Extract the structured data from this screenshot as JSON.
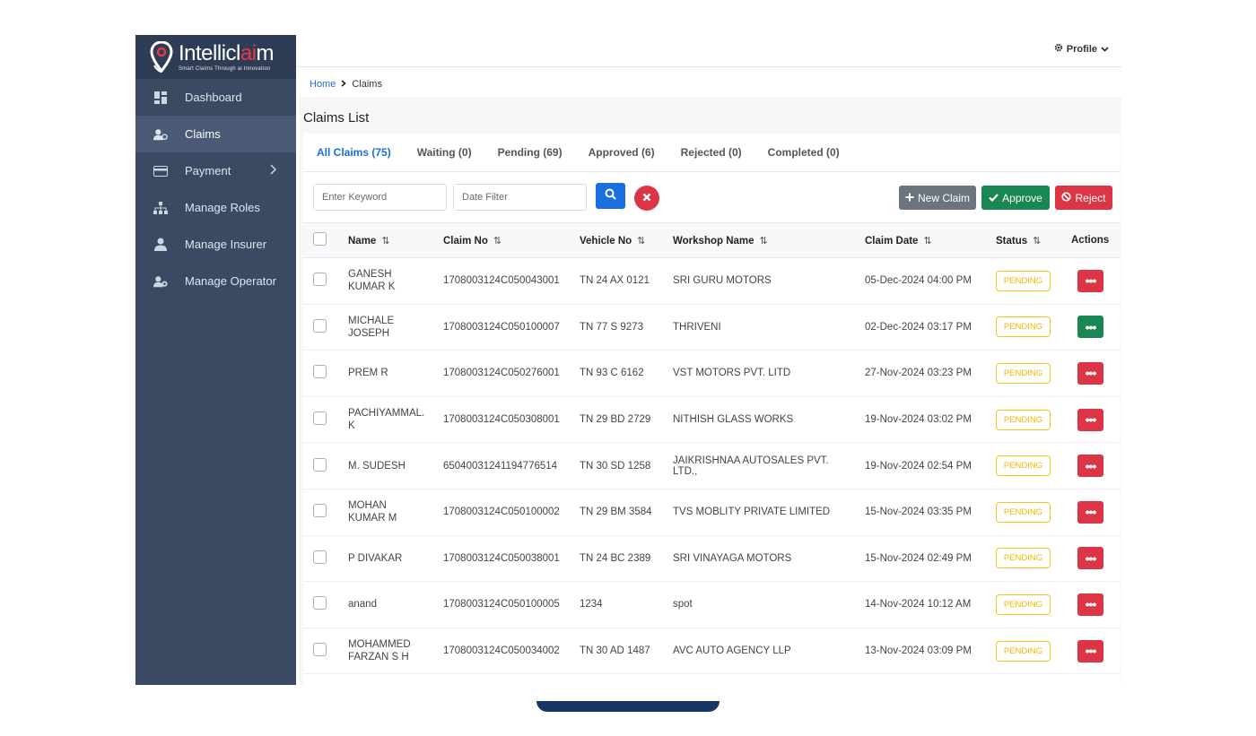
{
  "brand": {
    "name_pre": "Intellicl",
    "name_hl": "ai",
    "name_post": "m",
    "tagline": "Smart Claims Through ai Innovation"
  },
  "sidebar": {
    "items": [
      {
        "label": "Dashboard",
        "icon": "dashboard-icon"
      },
      {
        "label": "Claims",
        "icon": "claims-user-icon",
        "active": true
      },
      {
        "label": "Payment",
        "icon": "card-icon",
        "has_submenu": true
      },
      {
        "label": "Manage Roles",
        "icon": "sitemap-icon"
      },
      {
        "label": "Manage Insurer",
        "icon": "user-tie-icon"
      },
      {
        "label": "Manage Operator",
        "icon": "user-gear-icon"
      }
    ]
  },
  "topbar": {
    "profile_label": "Profile"
  },
  "breadcrumb": {
    "home": "Home",
    "current": "Claims"
  },
  "page": {
    "title": "Claims List"
  },
  "tabs": [
    {
      "label": "All Claims (75)",
      "active": true
    },
    {
      "label": "Waiting (0)"
    },
    {
      "label": "Pending (69)"
    },
    {
      "label": "Approved (6)"
    },
    {
      "label": "Rejected (0)"
    },
    {
      "label": "Completed (0)"
    }
  ],
  "filters": {
    "keyword_placeholder": "Enter Keyword",
    "date_placeholder": "Date Filter"
  },
  "actions": {
    "new_claim": "New Claim",
    "approve": "Approve",
    "reject": "Reject"
  },
  "table": {
    "columns": [
      "Name",
      "Claim No",
      "Vehicle No",
      "Workshop Name",
      "Claim Date",
      "Status",
      "Actions"
    ],
    "rows": [
      {
        "name": [
          "GANESH",
          "KUMAR K"
        ],
        "claim_no": "1708003124C050043001",
        "vehicle_no": "TN 24 AX 0121",
        "workshop": "SRI GURU MOTORS",
        "date": "05-Dec-2024 04:00 PM",
        "status": "PENDING",
        "action_color": "danger"
      },
      {
        "name": [
          "MICHALE",
          "JOSEPH"
        ],
        "claim_no": "1708003124C050100007",
        "vehicle_no": "TN 77 S 9273",
        "workshop": "THRIVENI",
        "date": "02-Dec-2024 03:17 PM",
        "status": "PENDING",
        "action_color": "success"
      },
      {
        "name": [
          "PREM R"
        ],
        "claim_no": "1708003124C050276001",
        "vehicle_no": "TN 93 C 6162",
        "workshop": "VST MOTORS PVT. LITD",
        "date": "27-Nov-2024 03:23 PM",
        "status": "PENDING",
        "action_color": "danger"
      },
      {
        "name": [
          "PACHIYAMMAL.",
          "K"
        ],
        "claim_no": "1708003124C050308001",
        "vehicle_no": "TN 29 BD 2729",
        "workshop": "NITHISH GLASS WORKS",
        "date": "19-Nov-2024 03:02 PM",
        "status": "PENDING",
        "action_color": "danger"
      },
      {
        "name": [
          "M. SUDESH"
        ],
        "claim_no": "65040031241194776514",
        "vehicle_no": "TN 30 SD 1258",
        "workshop": "JAIKRISHNAA AUTOSALES PVT. LTD.,",
        "date": "19-Nov-2024 02:54 PM",
        "status": "PENDING",
        "action_color": "danger"
      },
      {
        "name": [
          "MOHAN",
          "KUMAR M"
        ],
        "claim_no": "1708003124C050100002",
        "vehicle_no": "TN 29 BM 3584",
        "workshop": "TVS MOBLITY PRIVATE LIMITED",
        "date": "15-Nov-2024 03:35 PM",
        "status": "PENDING",
        "action_color": "danger"
      },
      {
        "name": [
          "P DIVAKAR"
        ],
        "claim_no": "1708003124C050038001",
        "vehicle_no": "TN 24 BC 2389",
        "workshop": "SRI VINAYAGA MOTORS",
        "date": "15-Nov-2024 02:49 PM",
        "status": "PENDING",
        "action_color": "danger"
      },
      {
        "name": [
          "anand"
        ],
        "claim_no": "1708003124C050100005",
        "vehicle_no": "1234",
        "workshop": "spot",
        "date": "14-Nov-2024 10:12 AM",
        "status": "PENDING",
        "action_color": "danger"
      },
      {
        "name": [
          "MOHAMMED",
          "FARZAN S H"
        ],
        "claim_no": "1708003124C050034002",
        "vehicle_no": "TN 30 AD 1487",
        "workshop": "AVC AUTO AGENCY LLP",
        "date": "13-Nov-2024 03:09 PM",
        "status": "PENDING",
        "action_color": "danger"
      }
    ]
  },
  "colors": {
    "sidebar": "#3a4a63",
    "primary": "#1a6fe0",
    "danger": "#dc3545",
    "success": "#198754",
    "secondary": "#6c757d",
    "pending": "#f5c518"
  }
}
